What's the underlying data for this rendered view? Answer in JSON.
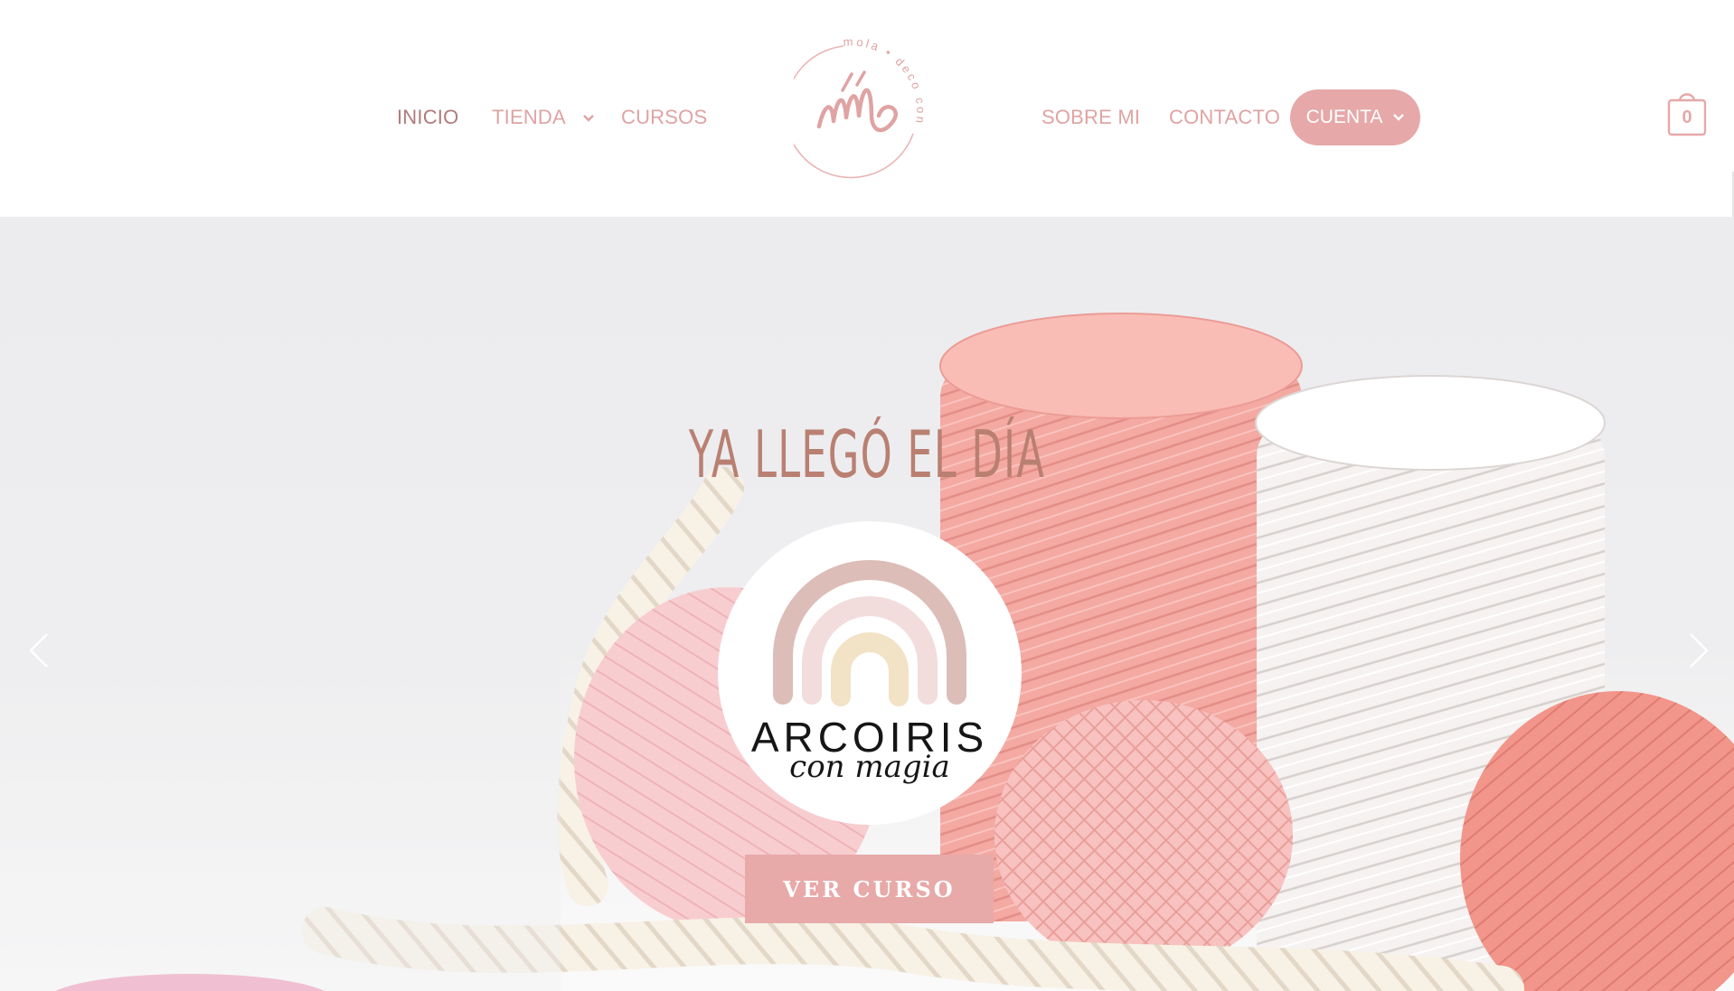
{
  "header": {
    "nav_left": [
      {
        "label": "INICIO"
      },
      {
        "label": "TIENDA"
      },
      {
        "label": "CURSOS"
      }
    ],
    "nav_right": [
      {
        "label": "SOBRE MI"
      },
      {
        "label": "CONTACTO"
      }
    ],
    "account_label": "CUENTA",
    "logo_ring_text": "mola • deco con amor",
    "cart_count": "0"
  },
  "hero": {
    "headline": "YA LLEGÓ EL DÍA",
    "badge_title": "ARCOIRIS",
    "badge_script": "con magia",
    "cta_label": "VER CURSO"
  },
  "colors": {
    "accent": "#e6a8a8",
    "nav_text": "#e0a3a3",
    "nav_active": "#b07a7a",
    "headline": "#b98072"
  },
  "icons": {
    "dropdown": "chevron-down-icon",
    "cart": "shopping-bag-icon",
    "prev": "chevron-left-icon",
    "next": "chevron-right-icon"
  }
}
